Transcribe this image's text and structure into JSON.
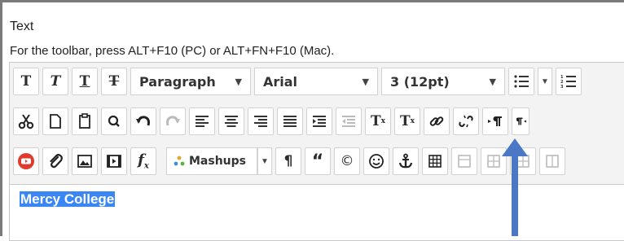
{
  "label": "Text",
  "hint": "For the toolbar, press ALT+F10 (PC) or ALT+FN+F10 (Mac).",
  "toolbar": {
    "row1": {
      "bold": "T",
      "italic": "T",
      "underline": "T",
      "strikethrough": "T",
      "format_select": "Paragraph",
      "font_select": "Arial",
      "size_select": "3 (12pt)"
    },
    "row2": {
      "superscript_label": "T",
      "subscript_label": "T"
    },
    "row3": {
      "mashups_label": "Mashups",
      "quote": "“",
      "copyright": "©"
    }
  },
  "content": {
    "selected_text": "Mercy College"
  },
  "colors": {
    "selection": "#3a86f5",
    "arrow": "#4a78c4",
    "youtube": "#e03a2f"
  }
}
